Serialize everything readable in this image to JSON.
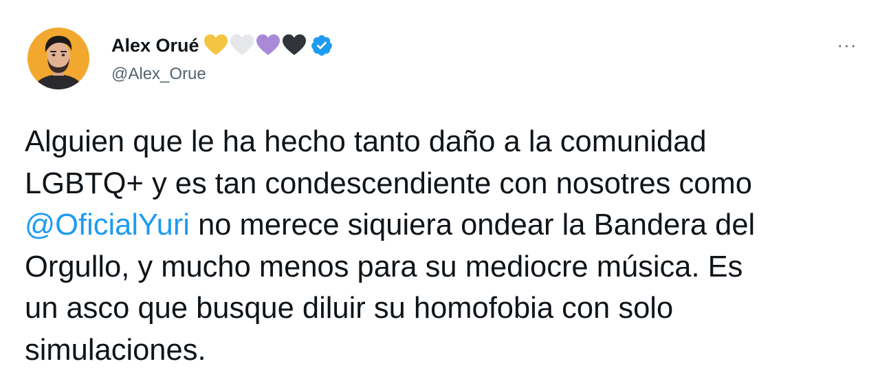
{
  "author": {
    "display_name": "Alex Orué",
    "handle": "@Alex_Orue",
    "verified": true,
    "name_hearts": [
      {
        "icon": "yellow-heart-icon",
        "color": "#f4c542"
      },
      {
        "icon": "white-heart-icon",
        "color": "#e6e7ea"
      },
      {
        "icon": "purple-heart-icon",
        "color": "#a98ad8"
      },
      {
        "icon": "black-heart-icon",
        "color": "#31343a"
      }
    ],
    "verified_color": "#1d9bf0",
    "avatar_bg": "#f2a82e"
  },
  "menu": {
    "label": "···",
    "icon": "more-options-icon"
  },
  "tweet": {
    "lines": {
      "l1": "Alguien que le ha hecho tanto daño a la comunidad",
      "l2": "LGBTQ+ y es tan condescendiente con nosotres como",
      "l3_mention": "@OficialYuri",
      "l3_rest": " no merece siquiera ondear la Bandera del",
      "l4": "Orgullo, y mucho menos para su mediocre música. Es",
      "l5": "un asco que busque diluir su homofobia con solo",
      "l6": "simulaciones."
    },
    "mention_color": "#1d9bf0"
  }
}
